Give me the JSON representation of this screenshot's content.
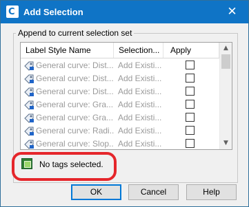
{
  "window": {
    "title": "Add Selection",
    "close_glyph": "✕"
  },
  "group": {
    "label": "Append to current selection set"
  },
  "table": {
    "columns": [
      "Label Style Name",
      "Selection...",
      "Apply"
    ],
    "rows": [
      {
        "name": "General curve: Dist...",
        "selection": "Add Existi..."
      },
      {
        "name": "General curve: Dist...",
        "selection": "Add Existi..."
      },
      {
        "name": "General curve: Dist...",
        "selection": "Add Existi..."
      },
      {
        "name": "General curve: Gra...",
        "selection": "Add Existi..."
      },
      {
        "name": "General curve: Gra...",
        "selection": "Add Existi..."
      },
      {
        "name": "General curve: Radi...",
        "selection": "Add Existi..."
      },
      {
        "name": "General curve: Slop...",
        "selection": "Add Existi..."
      }
    ]
  },
  "status": {
    "text": "No tags selected.",
    "icon": "tag-icon"
  },
  "buttons": {
    "ok": "OK",
    "cancel": "Cancel",
    "help": "Help"
  },
  "colors": {
    "titlebar": "#0f74c6",
    "annotation": "#e5262b"
  }
}
